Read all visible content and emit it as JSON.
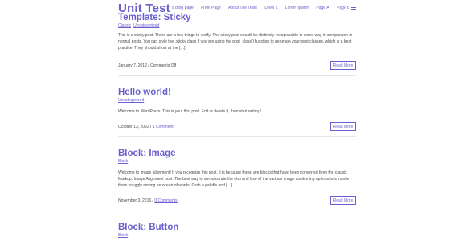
{
  "header": {
    "site_title": "Unit Test",
    "nav": [
      "a Blog page",
      "Front Page",
      "About The Tests",
      "Level 1",
      "Lorem Ipsum",
      "Page A",
      "Page B"
    ]
  },
  "posts": [
    {
      "title": "Template: Sticky",
      "categories": [
        "Classic",
        "Uncategorized"
      ],
      "excerpt": "This is a sticky post. There are a few things to verify: The sticky post should be distinctly recognizable in some way in comparison to normal posts. You can style the .sticky class if you are using the post_class() function to generate your post classes, which is a best practice. They should show at the […]",
      "date": "January 7, 2012",
      "comments": "Comments Off",
      "read_more": "Read More"
    },
    {
      "title": "Hello world!",
      "categories": [
        "Uncategorized"
      ],
      "excerpt": "Welcome to WordPress. This is your first post. Edit or delete it, then start writing!",
      "date": "October 13, 2022",
      "comments": "1 Comment",
      "read_more": "Read More"
    },
    {
      "title": "Block: Image",
      "categories": [
        "Block"
      ],
      "excerpt": "Welcome to image alignment! If you recognize this post, it is because these are blocks that have been converted from the classic Markup: Image Alignment post. The best way to demonstrate the ebb and flow of the various image positioning options is to nestle them snuggly among an ocean of words. Grab a paddle and […]",
      "date": "November 3, 2016",
      "comments": "0 Comments",
      "read_more": "Read More"
    },
    {
      "title": "Block: Button",
      "categories": [
        "Block"
      ]
    }
  ]
}
